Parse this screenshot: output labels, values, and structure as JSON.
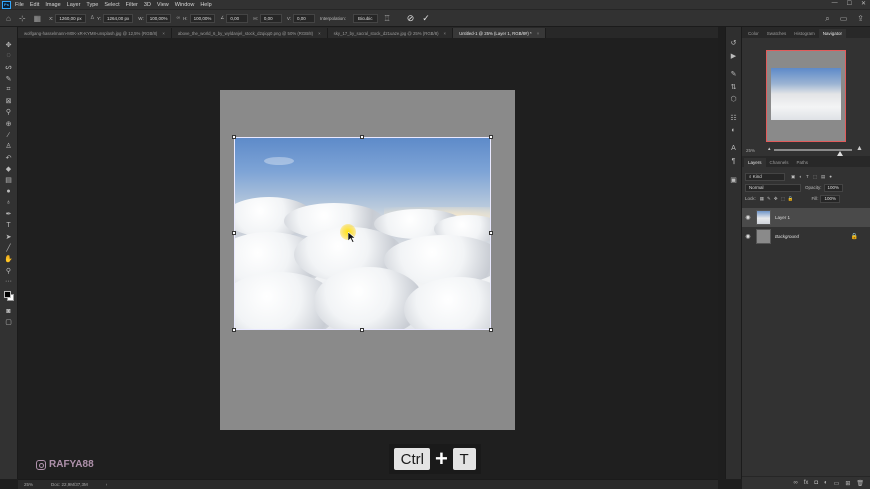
{
  "menubar": {
    "logo": "Ps",
    "items": [
      "File",
      "Edit",
      "Image",
      "Layer",
      "Type",
      "Select",
      "Filter",
      "3D",
      "View",
      "Window",
      "Help"
    ],
    "window_controls": [
      "—",
      "☐",
      "✕"
    ]
  },
  "options": {
    "x_label": "X:",
    "x_value": "1260,00 px",
    "y_label": "Y:",
    "y_value": "1264,00 px",
    "w_label": "W:",
    "w_value": "100,00%",
    "h_label": "H:",
    "h_value": "100,00%",
    "angle_value": "0,00",
    "hskew_label": "H:",
    "hskew_value": "0,00",
    "vskew_label": "V:",
    "vskew_value": "0,00",
    "interpolation_label": "Interpolation:",
    "interpolation_value": "Bicubic"
  },
  "tabs": [
    {
      "label": "wolfgang-hasselmann-M0K-xR-KYM8-unsplash.jpg @ 12,5% (RGB/8)",
      "active": false
    },
    {
      "label": "above_the_world_6_by_wyldanjel_stock_d2qiqq0.png @ 50% (RGB/8)",
      "active": false
    },
    {
      "label": "sky_17_by_sacral_stock_d21uaze.jpg @ 25% (RGB/8)",
      "active": false
    },
    {
      "label": "Untitled-1 @ 25% (Layer 1, RGB/8#) *",
      "active": true
    }
  ],
  "shortcut": {
    "key1": "Ctrl",
    "plus": "+",
    "key2": "T"
  },
  "watermark": "RAFYA88",
  "status": {
    "zoom": "25%",
    "doc": "Doc: 22,9M/37,3M",
    "arrow": "›"
  },
  "panels": {
    "top_tabs": [
      "Color",
      "Swatches",
      "Histogram",
      "Navigator"
    ],
    "active_top_tab": "Navigator",
    "zoom_value": "25%",
    "layer_tabs": [
      "Layers",
      "Channels",
      "Paths"
    ],
    "kind_label": "Kind",
    "blend_mode": "Normal",
    "opacity_label": "Opacity:",
    "opacity_value": "100%",
    "lock_label": "Lock:",
    "fill_label": "Fill:",
    "fill_value": "100%",
    "layers": [
      {
        "name": "Layer 1",
        "selected": true
      },
      {
        "name": "Background",
        "selected": false,
        "locked": true
      }
    ]
  },
  "icons": {
    "window_minimize": "minimize-icon",
    "cancel_transform": "cancel-icon",
    "commit_transform": "check-icon"
  }
}
